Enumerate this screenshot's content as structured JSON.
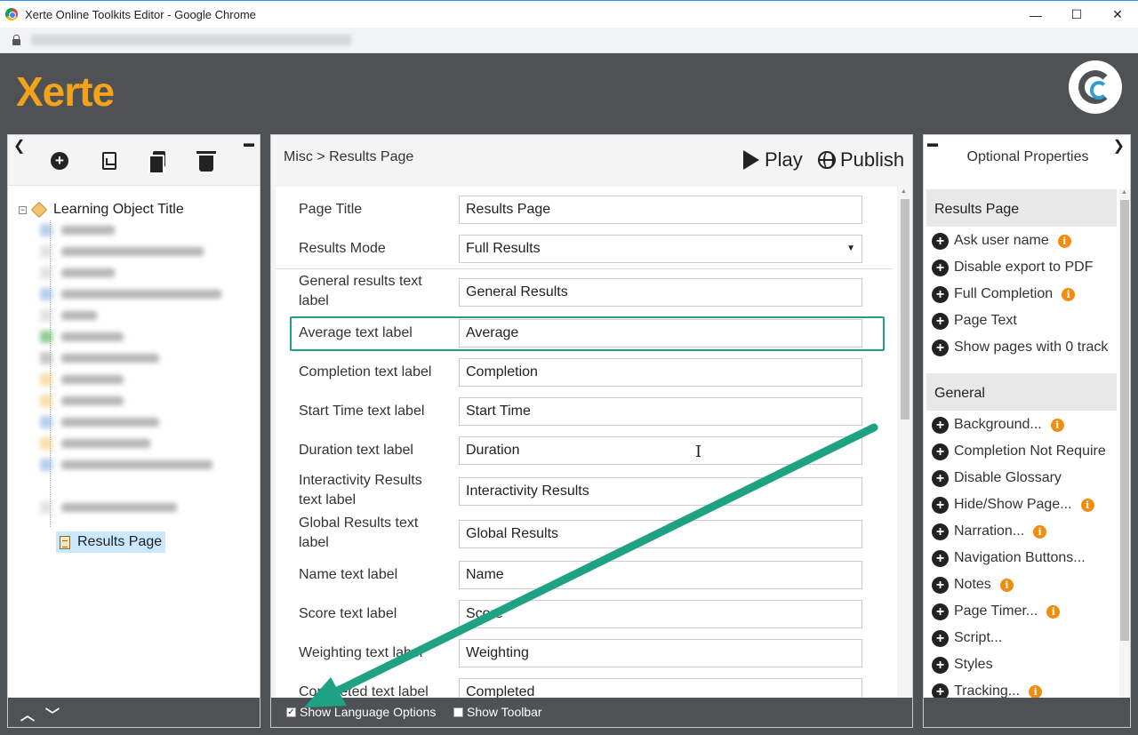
{
  "window": {
    "title": "Xerte Online Toolkits Editor - Google Chrome",
    "minimize": "—",
    "maximize": "☐",
    "close": "✕"
  },
  "header": {
    "logo": "Xerte"
  },
  "left_panel": {
    "collapse": "❮",
    "pin": "📌",
    "tree_root": "Learning Object Title",
    "selected_node": "Results Page",
    "foot_up": "︿",
    "foot_down": "﹀"
  },
  "center": {
    "breadcrumb": "Misc > Results Page",
    "play_label": "Play",
    "publish_label": "Publish",
    "fields": [
      {
        "label": "Page Title",
        "value": "Results Page"
      },
      {
        "label": "Results Mode",
        "value": "Full Results",
        "select_arrow": "▼"
      },
      {
        "label": "General results text label",
        "value": "General Results"
      },
      {
        "label": "Average text label",
        "value": "Average"
      },
      {
        "label": "Completion text label",
        "value": "Completion"
      },
      {
        "label": "Start Time text label",
        "value": "Start Time"
      },
      {
        "label": "Duration text label",
        "value": "Duration"
      },
      {
        "label": "Interactivity Results text label",
        "value": "Interactivity Results"
      },
      {
        "label": "Global Results text label",
        "value": "Global Results"
      },
      {
        "label": "Name text label",
        "value": "Name"
      },
      {
        "label": "Score text label",
        "value": "Score"
      },
      {
        "label": "Weighting text label",
        "value": "Weighting"
      },
      {
        "label": "Completed text label",
        "value": "Completed"
      }
    ],
    "show_language_options": {
      "label": "Show Language Options",
      "checked": true,
      "mark": "✓"
    },
    "show_toolbar": {
      "label": "Show Toolbar",
      "checked": false
    }
  },
  "right_panel": {
    "title": "Optional Properties",
    "collapse": "❯",
    "pin": "📌",
    "groups": [
      {
        "name": "Results Page",
        "items": [
          {
            "label": "Ask user name",
            "info": true
          },
          {
            "label": "Disable export to PDF",
            "info": false
          },
          {
            "label": "Full Completion",
            "info": true
          },
          {
            "label": "Page Text",
            "info": false
          },
          {
            "label": "Show pages with 0 track",
            "info": false
          }
        ]
      },
      {
        "name": "General",
        "items": [
          {
            "label": "Background...",
            "info": true
          },
          {
            "label": "Completion Not Require",
            "info": false
          },
          {
            "label": "Disable Glossary",
            "info": false
          },
          {
            "label": "Hide/Show Page...",
            "info": true
          },
          {
            "label": "Narration...",
            "info": true
          },
          {
            "label": "Navigation Buttons...",
            "info": false
          },
          {
            "label": "Notes",
            "info": true
          },
          {
            "label": "Page Timer...",
            "info": true
          },
          {
            "label": "Script...",
            "info": false
          },
          {
            "label": "Styles",
            "info": false
          },
          {
            "label": "Tracking...",
            "info": true
          }
        ]
      }
    ]
  },
  "colors": {
    "brand": "#f5a21b",
    "annotation": "#1fa183",
    "info": "#f28c0f",
    "bar": "#4e5254"
  },
  "icons": {
    "plus": "+",
    "info": "i"
  }
}
